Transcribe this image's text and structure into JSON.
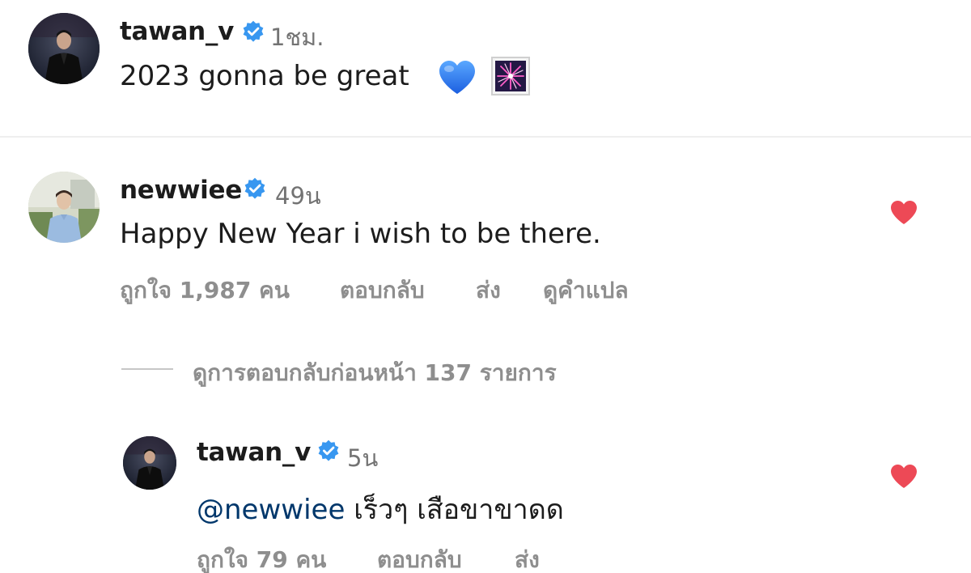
{
  "post": {
    "username": "tawan_v",
    "time": "1ชม.",
    "caption": "2023 gonna be great",
    "emojis": [
      "blue-heart-emoji",
      "fireworks-emoji"
    ]
  },
  "comment": {
    "username": "newwiee",
    "time": "49น",
    "text": "Happy New Year i wish to be there.",
    "likes_label": "ถูกใจ 1,987 คน",
    "reply_label": "ตอบกลับ",
    "send_label": "ส่ง",
    "translate_label": "ดูคำแปล",
    "liked": true
  },
  "view_replies_label": "ดูการตอบกลับก่อนหน้า 137 รายการ",
  "reply": {
    "username": "tawan_v",
    "time": "5น",
    "mention": "@newwiee",
    "text": "เร็วๆ เสือขาขาดด",
    "likes_label": "ถูกใจ 79 คน",
    "reply_label": "ตอบกลับ",
    "send_label": "ส่ง",
    "liked": true
  },
  "colors": {
    "verified_blue": "#3897f0",
    "heart_red": "#ed4956",
    "muted_text": "#8e8e8e",
    "mention_blue": "#00376b"
  }
}
